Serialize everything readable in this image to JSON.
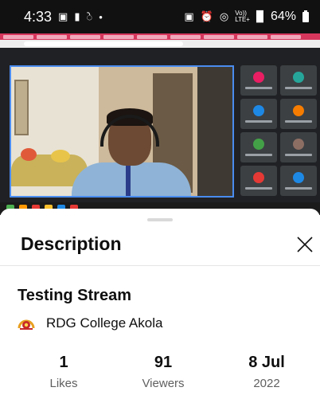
{
  "status_bar": {
    "time": "4:33",
    "network_top": "LTE+",
    "network_bottom": "LTE1",
    "volte": "Vo))",
    "battery": "64%"
  },
  "video": {
    "participant_tiles": [
      {
        "avatar_color": "#e91e63"
      },
      {
        "avatar_color": "#26a69a"
      },
      {
        "avatar_color": "#1e88e5"
      },
      {
        "avatar_color": "#f57c00"
      },
      {
        "avatar_color": "#43a047"
      },
      {
        "avatar_color": "#8d6e63"
      },
      {
        "avatar_color": "#e53935"
      },
      {
        "avatar_color": "#1e88e5"
      }
    ]
  },
  "description": {
    "title": "Description",
    "video_title": "Testing Stream",
    "channel_name": "RDG College Akola",
    "stats": [
      {
        "value": "1",
        "label": "Likes"
      },
      {
        "value": "91",
        "label": "Viewers"
      },
      {
        "value": "8 Jul",
        "label": "2022"
      }
    ]
  },
  "colors": {
    "accent_red": "#d6365c",
    "meet_bg": "#202124",
    "secondary_text": "#606060"
  }
}
